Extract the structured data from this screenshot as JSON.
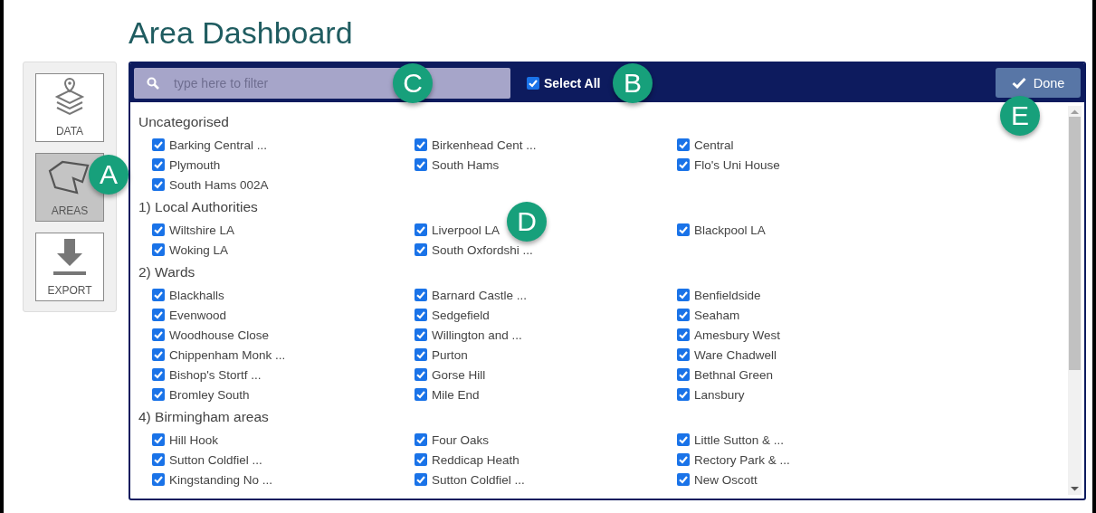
{
  "page": {
    "title": "Area Dashboard"
  },
  "sidebar": {
    "items": [
      {
        "label": "DATA",
        "kind": "layers",
        "selected": false
      },
      {
        "label": "AREAS",
        "kind": "polygon",
        "selected": true
      },
      {
        "label": "EXPORT",
        "kind": "download",
        "selected": false
      }
    ]
  },
  "toolbar": {
    "search": {
      "placeholder": "type here to filter"
    },
    "select_all": {
      "label": "Select All",
      "checked": true
    },
    "done_button": "Done"
  },
  "groups": [
    {
      "title": "Uncategorised",
      "items": [
        {
          "label": "Barking Central ...",
          "checked": true
        },
        {
          "label": "Birkenhead Cent ...",
          "checked": true
        },
        {
          "label": "Central",
          "checked": true
        },
        {
          "label": "Plymouth",
          "checked": true
        },
        {
          "label": "South Hams",
          "checked": true
        },
        {
          "label": "Flo's Uni House",
          "checked": true
        },
        {
          "label": "South Hams 002A",
          "checked": true
        }
      ]
    },
    {
      "title": "1) Local Authorities",
      "items": [
        {
          "label": "Wiltshire LA",
          "checked": true
        },
        {
          "label": "Liverpool LA",
          "checked": true
        },
        {
          "label": "Blackpool LA",
          "checked": true
        },
        {
          "label": "Woking LA",
          "checked": true
        },
        {
          "label": "South Oxfordshi ...",
          "checked": true
        }
      ]
    },
    {
      "title": "2) Wards",
      "items": [
        {
          "label": "Blackhalls",
          "checked": true
        },
        {
          "label": "Barnard Castle ...",
          "checked": true
        },
        {
          "label": "Benfieldside",
          "checked": true
        },
        {
          "label": "Evenwood",
          "checked": true
        },
        {
          "label": "Sedgefield",
          "checked": true
        },
        {
          "label": "Seaham",
          "checked": true
        },
        {
          "label": "Woodhouse Close",
          "checked": true
        },
        {
          "label": "Willington and ...",
          "checked": true
        },
        {
          "label": "Amesbury West",
          "checked": true
        },
        {
          "label": "Chippenham Monk ...",
          "checked": true
        },
        {
          "label": "Purton",
          "checked": true
        },
        {
          "label": "Ware Chadwell",
          "checked": true
        },
        {
          "label": "Bishop's Stortf ...",
          "checked": true
        },
        {
          "label": "Gorse Hill",
          "checked": true
        },
        {
          "label": "Bethnal Green",
          "checked": true
        },
        {
          "label": "Bromley South",
          "checked": true
        },
        {
          "label": "Mile End",
          "checked": true
        },
        {
          "label": "Lansbury",
          "checked": true
        }
      ]
    },
    {
      "title": "4) Birmingham areas",
      "items": [
        {
          "label": "Hill Hook",
          "checked": true
        },
        {
          "label": "Four Oaks",
          "checked": true
        },
        {
          "label": "Little Sutton & ...",
          "checked": true
        },
        {
          "label": "Sutton Coldfiel ...",
          "checked": true
        },
        {
          "label": "Reddicap Heath",
          "checked": true
        },
        {
          "label": "Rectory Park & ...",
          "checked": true
        },
        {
          "label": "Kingstanding No ...",
          "checked": true
        },
        {
          "label": "Sutton Coldfiel ...",
          "checked": true
        },
        {
          "label": "New Oscott",
          "checked": true
        }
      ]
    }
  ],
  "callouts": [
    {
      "label": "A"
    },
    {
      "label": "B"
    },
    {
      "label": "C"
    },
    {
      "label": "D"
    },
    {
      "label": "E"
    }
  ]
}
